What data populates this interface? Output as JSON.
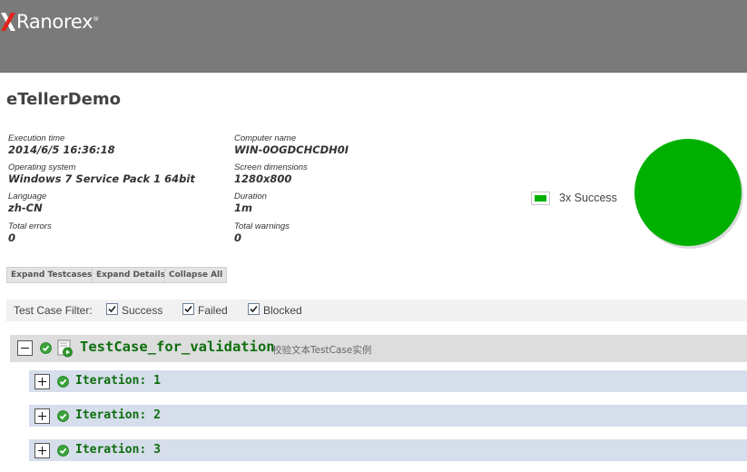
{
  "header": {
    "brand": "Ranorex",
    "brand_mark": "®"
  },
  "report": {
    "title": "eTellerDemo"
  },
  "info": {
    "execution_time": {
      "label": "Execution time",
      "value": "2014/6/5 16:36:18"
    },
    "computer_name": {
      "label": "Computer name",
      "value": "WIN-0OGDCHCDH0I"
    },
    "operating_system": {
      "label": "Operating system",
      "value": "Windows 7 Service Pack 1 64bit"
    },
    "screen_dimensions": {
      "label": "Screen dimensions",
      "value": "1280x800"
    },
    "language": {
      "label": "Language",
      "value": "zh-CN"
    },
    "duration": {
      "label": "Duration",
      "value": "1m"
    },
    "total_errors": {
      "label": "Total errors",
      "value": "0"
    },
    "total_warnings": {
      "label": "Total warnings",
      "value": "0"
    }
  },
  "buttons": {
    "expand_testcases": "Expand Testcases",
    "expand_details": "Expand Details",
    "collapse_all": "Collapse All"
  },
  "summary": {
    "legend_label": "3x Success",
    "success_count": 3,
    "success_color": "#00b000"
  },
  "filter": {
    "label": "Test Case Filter:",
    "options": [
      {
        "label": "Success",
        "checked": true
      },
      {
        "label": "Failed",
        "checked": true
      },
      {
        "label": "Blocked",
        "checked": true
      }
    ]
  },
  "testcase": {
    "name": "TestCase_for_validation",
    "description": "校验文本TestCase实例",
    "status": "success",
    "expanded": true,
    "iterations": [
      {
        "label": "Iteration: 1",
        "status": "success"
      },
      {
        "label": "Iteration: 2",
        "status": "success"
      },
      {
        "label": "Iteration: 3",
        "status": "success"
      }
    ]
  },
  "colors": {
    "header_bg": "#7a7a7a",
    "success_green": "#00b000",
    "testcase_text": "#0e6e0e",
    "iteration_bg": "#d6ddeb"
  },
  "icons": {
    "logo": "ranorex-logo-icon",
    "status": "success-check-icon",
    "testcase": "testcase-module-icon",
    "expand": "plus-icon",
    "collapse": "minus-icon"
  }
}
